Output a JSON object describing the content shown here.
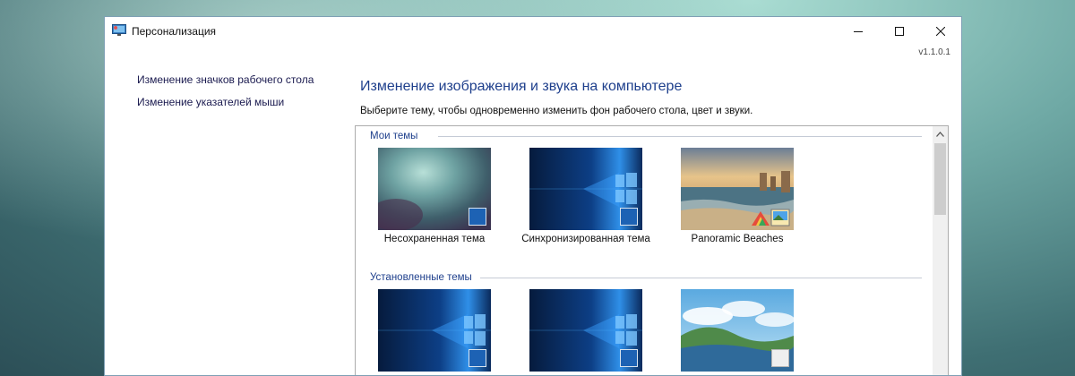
{
  "window": {
    "title": "Персонализация",
    "version": "v1.1.0.1"
  },
  "controls": {
    "minimize_icon": "minimize-icon",
    "maximize_icon": "maximize-icon",
    "close_icon": "close-icon"
  },
  "sidebar": {
    "items": [
      {
        "label": "Изменение значков рабочего стола"
      },
      {
        "label": "Изменение указателей мыши"
      }
    ]
  },
  "main": {
    "heading": "Изменение изображения и звука на компьютере",
    "description": "Выберите тему, чтобы одновременно изменить фон рабочего стола, цвет и звуки."
  },
  "groups": [
    {
      "title": "Мои темы",
      "themes": [
        {
          "name": "Несохраненная тема",
          "accent": "#1d62b4"
        },
        {
          "name": "Синхронизированная тема",
          "accent": "#1d62b4"
        },
        {
          "name": "Panoramic Beaches"
        }
      ]
    },
    {
      "title": "Установленные темы",
      "themes": [
        {
          "name": "",
          "accent": "#1d62b4"
        },
        {
          "name": "",
          "accent": "#1d62b4"
        },
        {
          "name": "",
          "accent": "#efefef"
        }
      ]
    }
  ],
  "colors": {
    "heading": "#1e3f8c",
    "accent": "#1d62b4"
  }
}
